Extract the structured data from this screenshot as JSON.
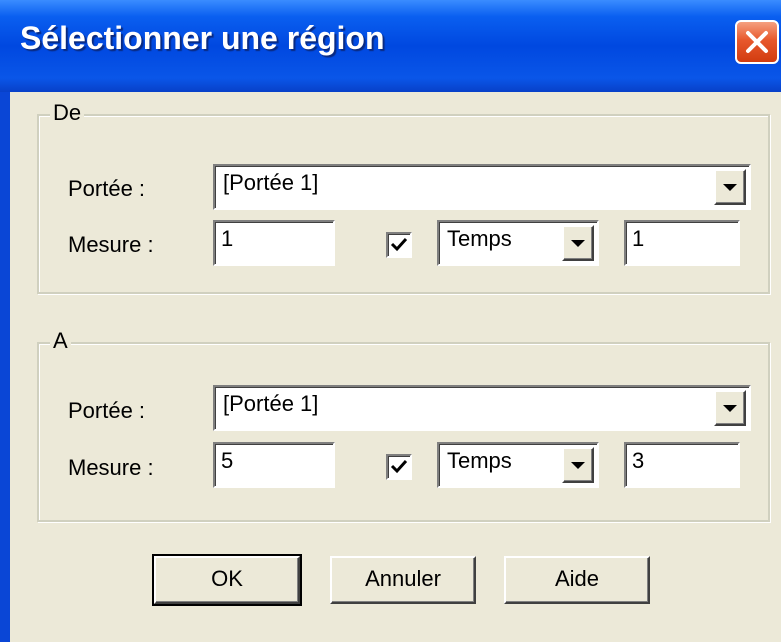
{
  "window": {
    "title": "Sélectionner une région",
    "close_icon": "close-icon"
  },
  "from": {
    "group_label": "De",
    "staff_label": "Portée :",
    "staff_value": "[Portée 1]",
    "measure_label": "Mesure :",
    "measure_value": "1",
    "beat_checked": true,
    "unit_value": "Temps",
    "beat_value": "1"
  },
  "to": {
    "group_label": "A",
    "staff_label": "Portée :",
    "staff_value": "[Portée 1]",
    "measure_label": "Mesure :",
    "measure_value": "5",
    "beat_checked": true,
    "unit_value": "Temps",
    "beat_value": "3"
  },
  "buttons": {
    "ok": "OK",
    "cancel": "Annuler",
    "help": "Aide"
  },
  "colors": {
    "titlebar": "#0a5ff0",
    "face": "#ece9d8",
    "close": "#e8582c"
  }
}
